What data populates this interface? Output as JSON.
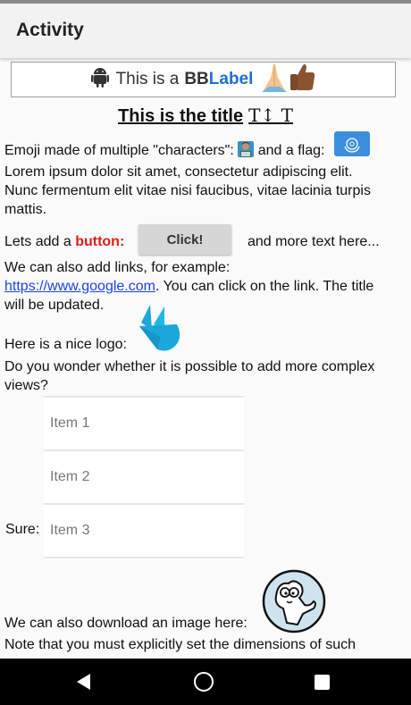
{
  "appbar": {
    "title": "Activity"
  },
  "bblabel": {
    "prefix": "This is a",
    "bb": "BB",
    "label": "Label"
  },
  "doc_title": {
    "text": "This is the title",
    "glyphs": "T↕ T"
  },
  "paragraph1": {
    "emoji_text": "Emoji made of multiple \"characters\":",
    "flag_text": "and a flag:",
    "lorem": "Lorem ipsum dolor sit amet, consectetur adipiscing elit. Nunc fermentum elit vitae nisi faucibus, vitae lacinia turpis mattis."
  },
  "button_row": {
    "prefix": "Lets add a",
    "highlight": "button:",
    "button_label": "Click!",
    "suffix": "and more text here..."
  },
  "paragraph2": {
    "before": "We can also add links, for example:",
    "link": "https://www.google.com",
    "after": ". You can click on the link. The title will be updated."
  },
  "logo_row": {
    "text": "Here is a nice logo:"
  },
  "paragraph3": {
    "text": "Do you wonder whether it is possible to add more complex views?"
  },
  "list": {
    "label": "Sure:",
    "items": [
      "Item 1",
      "Item 2",
      "Item 3"
    ]
  },
  "image_row": {
    "text": "We can also download an image here:"
  },
  "paragraph4": {
    "text": "Note that you must explicitly set the dimensions of such"
  },
  "colors": {
    "link": "#1a44e6",
    "highlight": "#e01b1b",
    "bb_label": "#1e6fd6",
    "logo": "#1aa7d9"
  },
  "icons": [
    "android-icon",
    "folded-hands-icon",
    "thumbs-up-icon",
    "technologist-emoji-icon",
    "un-flag-icon",
    "logo-icon",
    "cat-image",
    "back-icon",
    "home-icon",
    "recents-icon"
  ]
}
